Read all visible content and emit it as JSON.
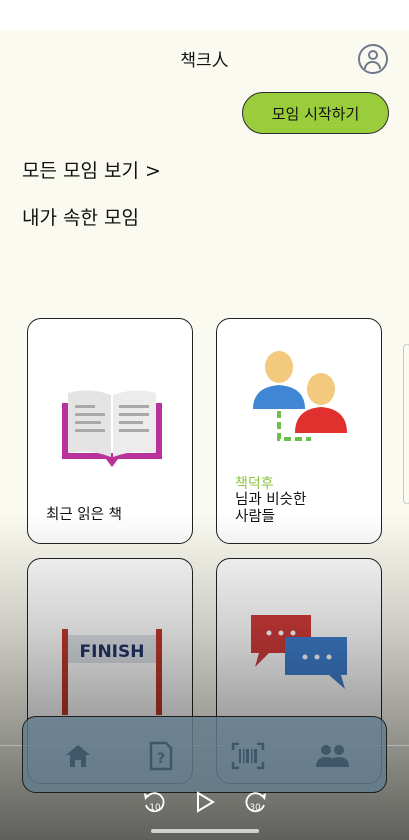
{
  "app": {
    "title": "책크人"
  },
  "header": {
    "start_button": "모임 시작하기"
  },
  "links": {
    "all_meetings": "모든 모임 보기 >",
    "my_meetings": "내가 속한 모임"
  },
  "cards": [
    {
      "label": "최근 읽은 책",
      "icon": "open-book-icon"
    },
    {
      "tag": "책덕후",
      "label_line1": "님과 비슷한",
      "label_line2": "사람들",
      "icon": "similar-people-icon"
    },
    {
      "icon": "finish-banner-icon",
      "banner_text": "FINISH"
    },
    {
      "icon": "chat-bubbles-icon"
    }
  ],
  "bottom_nav": [
    "home-icon",
    "quiz-icon",
    "barcode-icon",
    "group-icon"
  ],
  "media": {
    "rewind": "10",
    "forward": "30"
  },
  "colors": {
    "accent": "#9acd3b",
    "nav_bg": "#617c8d"
  }
}
